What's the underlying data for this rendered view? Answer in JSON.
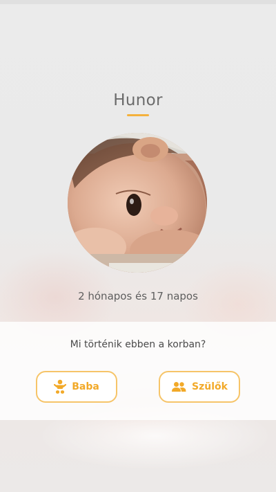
{
  "profile": {
    "name": "Hunor",
    "age_text": "2 hónapos és 17 napos"
  },
  "section": {
    "question": "Mi történik ebben a korban?"
  },
  "buttons": {
    "baba_label": "Baba",
    "szulok_label": "Szülők"
  },
  "icons": {
    "baba": "baby-icon",
    "szulok": "parents-icon"
  },
  "colors": {
    "accent": "#f4b13c",
    "button_border": "#f6c468",
    "text": "#6b6b6b"
  }
}
